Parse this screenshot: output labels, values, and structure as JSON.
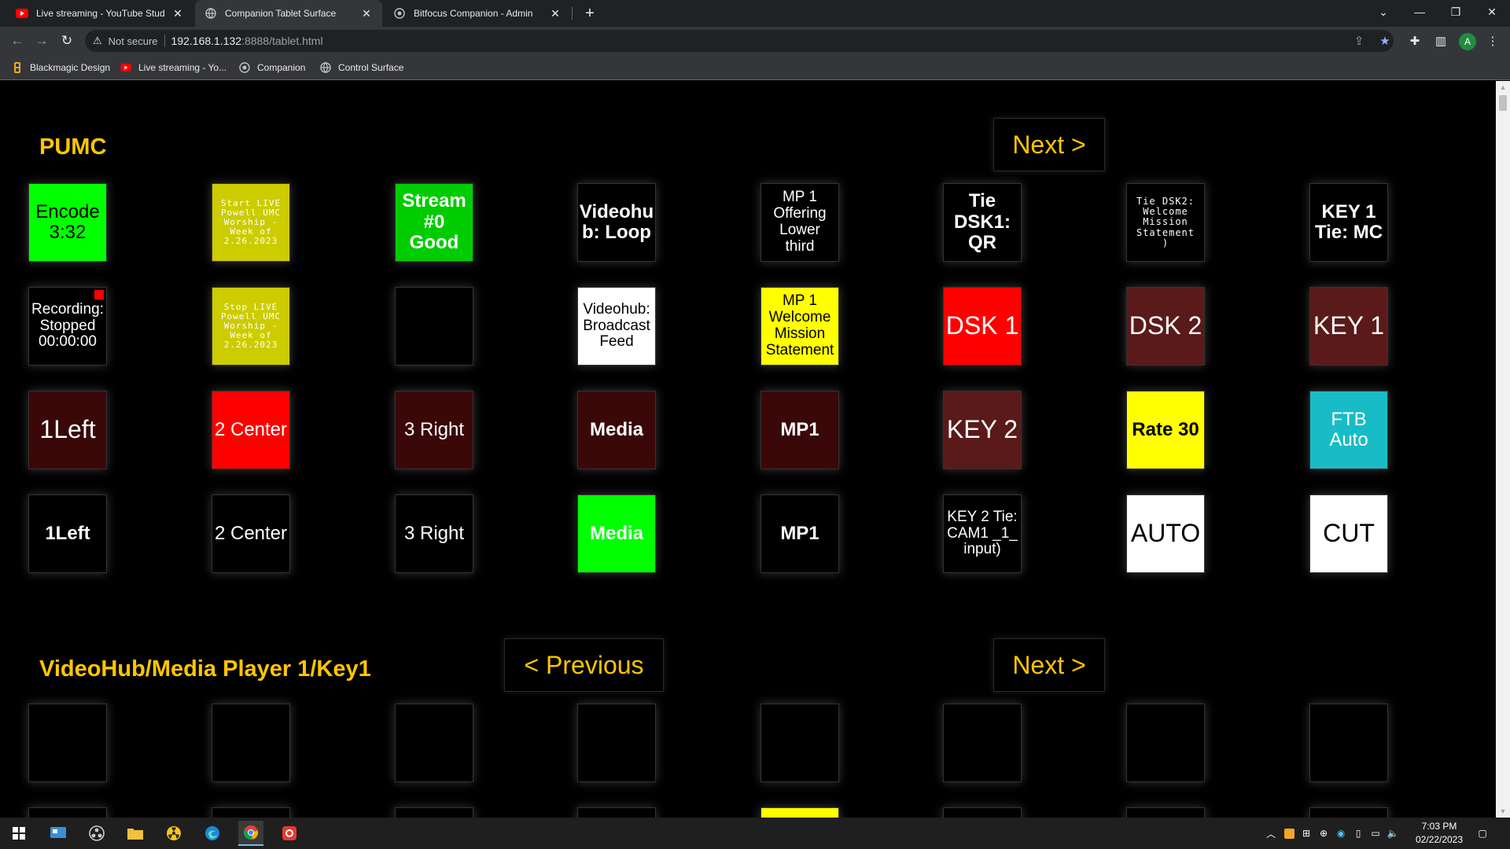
{
  "browser": {
    "tabs": [
      {
        "title": "Live streaming - YouTube Studio",
        "active": false
      },
      {
        "title": "Companion Tablet Surface",
        "active": true
      },
      {
        "title": "Bitfocus Companion - Admin",
        "active": false
      }
    ],
    "address": {
      "security": "Not secure",
      "host": "192.168.1.132",
      "path": ":8888/tablet.html"
    },
    "avatar_letter": "A",
    "bookmarks": [
      "Blackmagic Design",
      "Live streaming - Yo...",
      "Companion",
      "Control Surface"
    ]
  },
  "page": {
    "sections": [
      {
        "title": "PUMC",
        "prev": "",
        "next": "Next >"
      },
      {
        "title": "VideoHub/Media Player 1/Key1",
        "prev": "< Previous",
        "next": "Next >"
      }
    ],
    "buttons_page1": [
      {
        "text": "Encode\n3:32",
        "bg": "#00ff00",
        "fg": "#000000",
        "size": 24,
        "bold": false
      },
      {
        "text": "Start LIVE\nPowell UMC\nWorship -\nWeek of\n2.26.2023",
        "bg": "#cccc00",
        "fg": "#ffffff",
        "size": 11,
        "mono": true
      },
      {
        "text": "Stream\n#0\nGood",
        "bg": "#00cc00",
        "fg": "#ffffff",
        "size": 24,
        "bold": true
      },
      {
        "text": "Videohu\nb: Loop",
        "bg": "#000000",
        "fg": "#ffffff",
        "size": 24,
        "bold": true
      },
      {
        "text": "MP 1\nOffering\nLower\nthird",
        "bg": "#000000",
        "fg": "#ffffff",
        "size": 19
      },
      {
        "text": "Tie\nDSK1:\nQR",
        "bg": "#000000",
        "fg": "#ffffff",
        "size": 24,
        "bold": true
      },
      {
        "text": "Tie DSK2:\nWelcome\nMission\nStatement\n)",
        "bg": "#000000",
        "fg": "#ffffff",
        "size": 12,
        "mono": true
      },
      {
        "text": "KEY 1\nTie: MC",
        "bg": "#000000",
        "fg": "#ffffff",
        "size": 24,
        "bold": true
      },
      {
        "text": "Recording:\nStopped\n00:00:00",
        "bg": "#000000",
        "fg": "#ffffff",
        "size": 19,
        "rec": true
      },
      {
        "text": "Stop LIVE\nPowell UMC\nWorship -\nWeek of\n2.26.2023",
        "bg": "#cccc00",
        "fg": "#ffffff",
        "size": 11,
        "mono": true
      },
      {
        "text": "",
        "bg": "#000000",
        "fg": "#ffffff",
        "size": 24
      },
      {
        "text": "Videohub:\nBroadcast\nFeed",
        "bg": "#ffffff",
        "fg": "#000000",
        "size": 19
      },
      {
        "text": "MP 1\nWelcome\nMission\nStatement",
        "bg": "#ffff00",
        "fg": "#000000",
        "size": 19
      },
      {
        "text": "DSK 1",
        "bg": "#ff0000",
        "fg": "#ffffff",
        "size": 32
      },
      {
        "text": "DSK 2",
        "bg": "#5a1a1a",
        "fg": "#ffffff",
        "size": 32
      },
      {
        "text": "KEY 1",
        "bg": "#5a1a1a",
        "fg": "#ffffff",
        "size": 32
      },
      {
        "text": "1Left",
        "bg": "#3a0808",
        "fg": "#ffffff",
        "size": 32
      },
      {
        "text": "2 Center",
        "bg": "#ff0000",
        "fg": "#ffffff",
        "size": 24
      },
      {
        "text": "3 Right",
        "bg": "#3a0808",
        "fg": "#ffffff",
        "size": 24
      },
      {
        "text": "Media",
        "bg": "#3a0808",
        "fg": "#ffffff",
        "size": 24,
        "bold": true
      },
      {
        "text": "MP1",
        "bg": "#3a0808",
        "fg": "#ffffff",
        "size": 24,
        "bold": true
      },
      {
        "text": "KEY 2",
        "bg": "#5a1a1a",
        "fg": "#ffffff",
        "size": 32
      },
      {
        "text": "Rate 30",
        "bg": "#ffff00",
        "fg": "#000000",
        "size": 24,
        "bold": true
      },
      {
        "text": "FTB\nAuto",
        "bg": "#18bcc6",
        "fg": "#ffffff",
        "size": 24
      },
      {
        "text": "1Left",
        "bg": "#000000",
        "fg": "#ffffff",
        "size": 24,
        "bold": true
      },
      {
        "text": "2 Center",
        "bg": "#000000",
        "fg": "#ffffff",
        "size": 24
      },
      {
        "text": "3 Right",
        "bg": "#000000",
        "fg": "#ffffff",
        "size": 24
      },
      {
        "text": "Media",
        "bg": "#00ff00",
        "fg": "#ffffff",
        "size": 24,
        "bold": true
      },
      {
        "text": "MP1",
        "bg": "#000000",
        "fg": "#ffffff",
        "size": 24,
        "bold": true
      },
      {
        "text": "KEY 2 Tie:\nCAM1 _1_\ninput)",
        "bg": "#000000",
        "fg": "#ffffff",
        "size": 19
      },
      {
        "text": "AUTO",
        "bg": "#ffffff",
        "fg": "#000000",
        "size": 32
      },
      {
        "text": "CUT",
        "bg": "#ffffff",
        "fg": "#000000",
        "size": 32
      }
    ],
    "buttons_page2": [
      {
        "text": "",
        "bg": "#000000"
      },
      {
        "text": "",
        "bg": "#000000"
      },
      {
        "text": "",
        "bg": "#000000"
      },
      {
        "text": "",
        "bg": "#000000"
      },
      {
        "text": "",
        "bg": "#000000"
      },
      {
        "text": "",
        "bg": "#000000"
      },
      {
        "text": "",
        "bg": "#000000"
      },
      {
        "text": "",
        "bg": "#000000"
      }
    ],
    "buttons_page2_row2": [
      {
        "text": "",
        "bg": "#000000"
      },
      {
        "text": "",
        "bg": "#000000"
      },
      {
        "text": "",
        "bg": "#000000"
      },
      {
        "text": "",
        "bg": "#000000"
      },
      {
        "text": "",
        "bg": "#ffff00"
      },
      {
        "text": "",
        "bg": "#000000"
      },
      {
        "text": "",
        "bg": "#000000"
      },
      {
        "text": "",
        "bg": "#000000"
      }
    ]
  },
  "taskbar": {
    "time": "7:03 PM",
    "date": "02/22/2023"
  }
}
